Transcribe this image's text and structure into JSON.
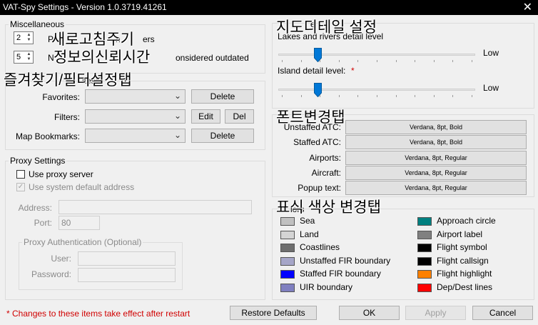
{
  "window": {
    "title": "VAT-Spy Settings - Version 1.0.3719.41261",
    "close": "✕"
  },
  "misc": {
    "legend": "Miscellaneous",
    "spin1_value": "2",
    "spin1_label_a": "P",
    "spin1_label_b": "n",
    "spin1_label_c": "ers",
    "spin2_value": "5",
    "spin2_label_a": "N",
    "spin2_label_b": "onsidered outdated"
  },
  "favorites": {
    "legend_partial": "ites/F",
    "legend_tail": "o",
    "favorites_label": "Favorites:",
    "filters_label": "Filters:",
    "bookmarks_label": "Map Bookmarks:",
    "delete_label": "Delete",
    "edit_label": "Edit",
    "del_label": "Del",
    "bookmarks_delete_label": "Delete"
  },
  "proxy": {
    "legend": "Proxy Settings",
    "use_proxy": "Use proxy server",
    "use_default": "Use system default address",
    "address_label": "Address:",
    "port_label": "Port:",
    "port_value": "80",
    "auth_legend": "Proxy Authentication (Optional)",
    "user_label": "User:",
    "password_label": "Password:"
  },
  "map_detail": {
    "legend_tail": "e",
    "lakes_label": "Lakes and rivers detail level",
    "island_label": "Island detail level:",
    "asterisk": "*",
    "low1": "Low",
    "low2": "Low",
    "lakes_level": 0.2,
    "island_level": 0.2
  },
  "fonts": {
    "legend_tail": "n",
    "rows": [
      {
        "label": "Unstaffed ATC:",
        "value": "Verdana, 8pt, Bold"
      },
      {
        "label": "Staffed ATC:",
        "value": "Verdana, 8pt, Bold"
      },
      {
        "label": "Airports:",
        "value": "Verdana, 8pt, Regular"
      },
      {
        "label": "Aircraft:",
        "value": "Verdana, 8pt, Regular"
      },
      {
        "label": "Popup text:",
        "value": "Verdana, 8pt, Regular"
      }
    ]
  },
  "colors": {
    "legend_tail": "lors",
    "left": [
      {
        "label": "Sea",
        "color": "#c0c0c0"
      },
      {
        "label": "Land",
        "color": "#d4d4d4"
      },
      {
        "label": "Coastlines",
        "color": "#6e6e6e"
      },
      {
        "label": "Unstaffed FIR boundary",
        "color": "#a6a6c8"
      },
      {
        "label": "Staffed FIR boundary",
        "color": "#0000ff"
      },
      {
        "label": "UIR boundary",
        "color": "#8080c0"
      }
    ],
    "right": [
      {
        "label": "Approach circle",
        "color": "#008080"
      },
      {
        "label": "Airport label",
        "color": "#808080"
      },
      {
        "label": "Flight symbol",
        "color": "#000000"
      },
      {
        "label": "Flight callsign",
        "color": "#000000"
      },
      {
        "label": "Flight highlight",
        "color": "#ff8000"
      },
      {
        "label": "Dep/Dest lines",
        "color": "#ff0000"
      }
    ]
  },
  "footer": {
    "note": "* Changes to these items take effect after restart",
    "restore": "Restore Defaults",
    "ok": "OK",
    "apply": "Apply",
    "cancel": "Cancel"
  },
  "annotations": {
    "refresh_cycle": "새로고침주기",
    "info_reliability": "정보의신뢰시간",
    "favorites_filter_tab": "즐겨찾기/필터설정탭",
    "map_detail_settings": "지도디테일 설정",
    "font_change_tab": "폰트변경탭",
    "color_change_tab": "표식 색상 변경탭"
  }
}
